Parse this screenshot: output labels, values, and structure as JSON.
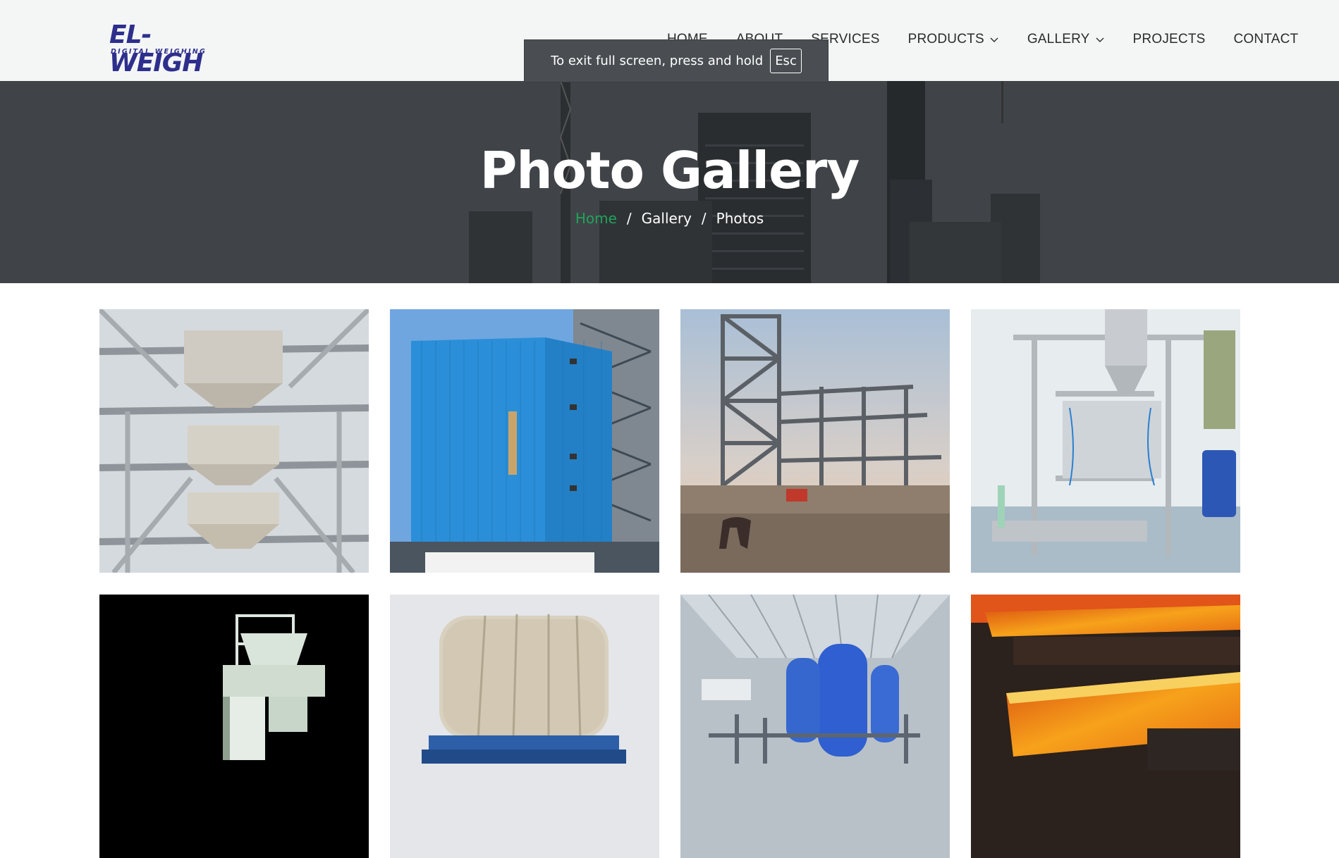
{
  "logo": {
    "main": "EL-WEIGH",
    "sub": "DIGITAL WEIGHING"
  },
  "nav": [
    {
      "label": "HOME"
    },
    {
      "label": "ABOUT"
    },
    {
      "label": "SERVICES"
    },
    {
      "label": "PRODUCTS",
      "dropdown": true
    },
    {
      "label": "GALLERY",
      "dropdown": true
    },
    {
      "label": "PROJECTS"
    },
    {
      "label": "CONTACT"
    }
  ],
  "toast": {
    "text": "To exit full screen, press and hold",
    "key": "Esc"
  },
  "hero": {
    "title": "Photo Gallery",
    "breadcrumb": {
      "home": "Home",
      "gallery": "Gallery",
      "current": "Photos",
      "separator": "/"
    }
  },
  "gallery": {
    "photos": [
      {
        "subject": "steel-hopper-structure"
      },
      {
        "subject": "blue-clad-building"
      },
      {
        "subject": "steel-frame-construction-site"
      },
      {
        "subject": "stainless-bagging-machine"
      },
      {
        "subject": "white-bagging-machine"
      },
      {
        "subject": "cotton-bale-on-scale"
      },
      {
        "subject": "blue-pressure-tanks"
      },
      {
        "subject": "hot-steel-billets"
      }
    ]
  },
  "colors": {
    "nav_text": "#2b2b2b",
    "header_bg": "#f4f6f6",
    "breadcrumb_home": "#1fa35a",
    "logo": "#2e2f8c"
  }
}
